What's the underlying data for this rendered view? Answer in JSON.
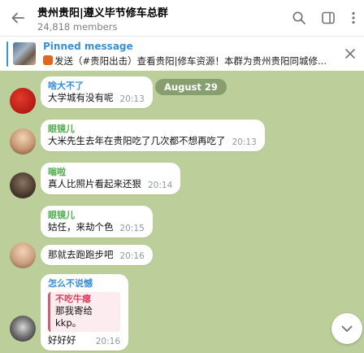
{
  "header": {
    "title": "贵州贵阳|遵义毕节修车总群",
    "subtitle": "24,818 members"
  },
  "pinned": {
    "title": "Pinned message",
    "text": "发送（#贵阳出击）查看贵阳|修车资源！本群为贵州贵阳同城修..."
  },
  "date_divider": "August 29",
  "messages": [
    {
      "sender": "啥大不了",
      "sender_color": "#3a8fd6",
      "text": "大学城有没有呢",
      "time": "20:13"
    },
    {
      "sender": "眼镜儿",
      "sender_color": "#4fae4e",
      "text": "大米先生去年在贵阳吃了几次都不想再吃了",
      "time": "20:13"
    },
    {
      "sender": "嗡啦",
      "sender_color": "#4fae4e",
      "text": "真人比照片看起来还狠",
      "time": "20:14"
    },
    {
      "sender": "眼镜儿",
      "sender_color": "#4fae4e",
      "text": "姑任，来劫个色",
      "time": "20:15"
    },
    {
      "sender": "",
      "text": "那就去跑跑步吧",
      "time": "20:16"
    },
    {
      "sender": "怎么不说憾",
      "sender_color": "#3a8fd6",
      "reply_name": "不吃牛瘪",
      "reply_text": "那我寄给kkp。",
      "text": "好好好",
      "time": "20:16"
    }
  ],
  "colors": {
    "accent": "#3a95d5",
    "chat_bg": "#bccf9a",
    "reply_accent": "#e0566f"
  },
  "icons": [
    "back-arrow-icon",
    "search-icon",
    "sidebar-toggle-icon",
    "more-vertical-icon",
    "close-icon",
    "chevron-down-icon"
  ]
}
